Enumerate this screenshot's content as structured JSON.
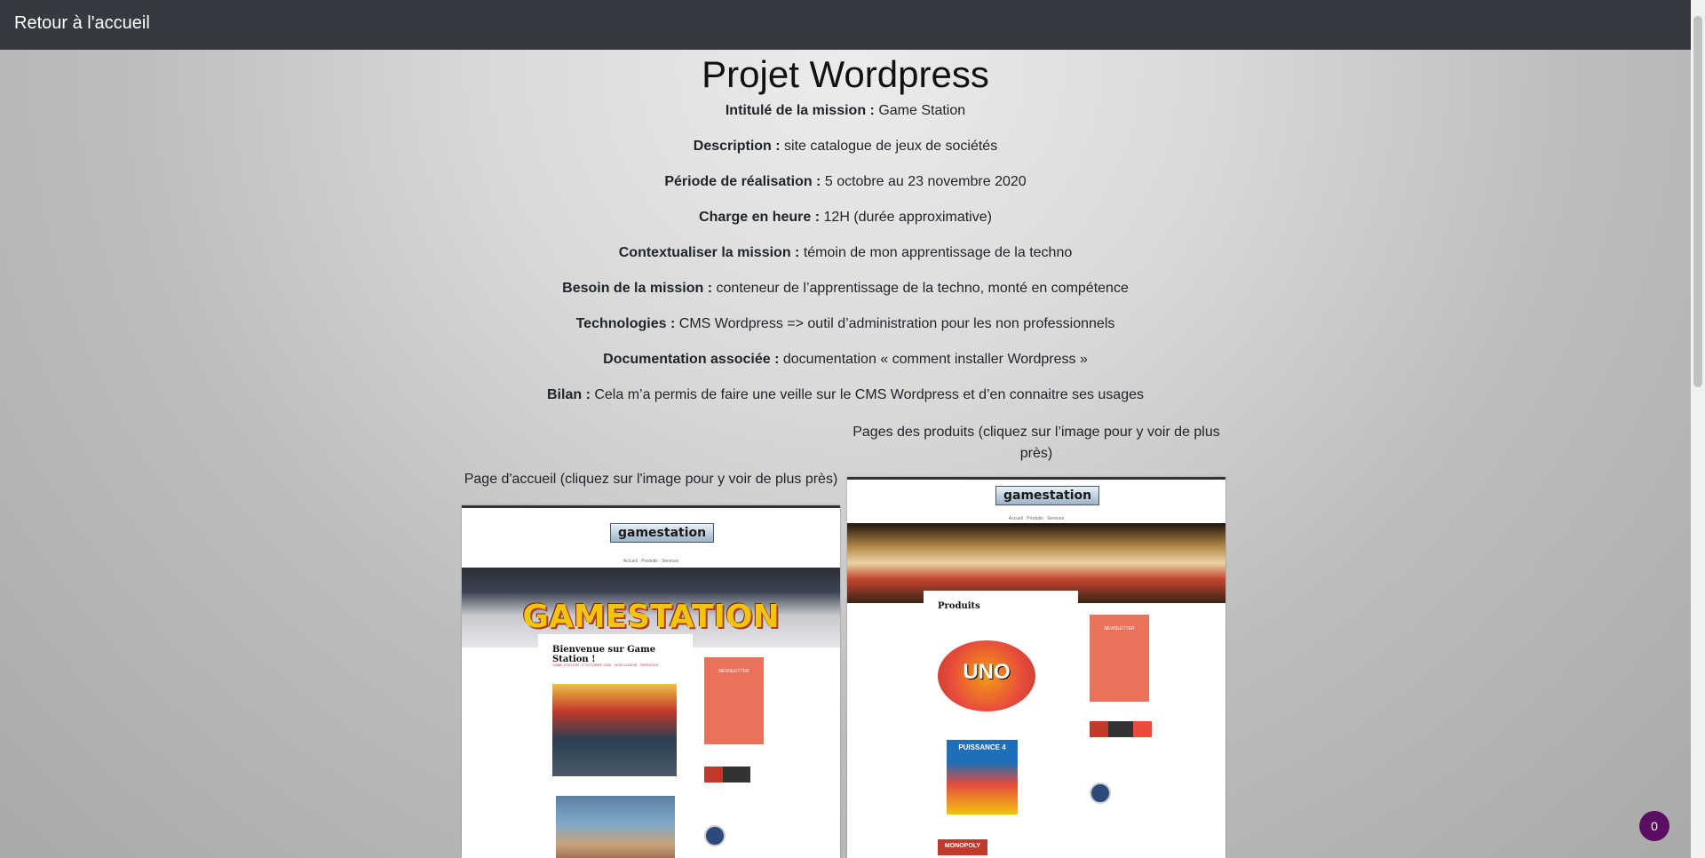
{
  "topbar": {
    "home_link": "Retour à l'accueil"
  },
  "page": {
    "title": "Projet Wordpress"
  },
  "fields": [
    {
      "label": "Intitulé de la mission :",
      "value": "Game Station"
    },
    {
      "label": "Description :",
      "value": "site catalogue de jeux de sociétés"
    },
    {
      "label": "Période de réalisation :",
      "value": "5 octobre au 23 novembre 2020"
    },
    {
      "label": "Charge en heure :",
      "value": "12H (durée approximative)"
    },
    {
      "label": "Contextualiser la mission :",
      "value": "témoin de mon apprentissage de la techno"
    },
    {
      "label": "Besoin de la mission :",
      "value": "conteneur de l’apprentissage de la techno, monté en compétence"
    },
    {
      "label": "Technologies :",
      "value": "CMS Wordpress => outil d’administration pour les non professionnels"
    },
    {
      "label": "Documentation associée :",
      "value": "documentation « comment installer Wordpress »"
    },
    {
      "label": "Bilan :",
      "value": "Cela m’a permis de faire une veille sur le CMS Wordpress et d’en connaitre ses usages"
    }
  ],
  "gallery": {
    "home_caption": "Page d'accueil (cliquez sur l'image pour y voir de plus près)",
    "products_caption_line1": "Pages des produits (cliquez sur l’image pour y voir de plus",
    "products_caption_line2": "près)"
  },
  "home_shot": {
    "logo": "gamestation",
    "nav": "Accueil · Produits · Services",
    "hero_text": "GAMESTATION",
    "card_title": "Bienvenue sur Game Station !",
    "card_meta": "GAME STATION · 5 OCTOBRE 2020 · NON CLASSÉ · SERVICES",
    "newsletter": "NEWSLETTER"
  },
  "products_shot": {
    "logo": "gamestation",
    "nav": "Accueil · Produits · Services",
    "card_title": "Produits",
    "product_1": "UNO",
    "product_2": "PUISSANCE 4",
    "product_3": "MONOPOLY",
    "newsletter": "NEWSLETTER"
  },
  "chat_widget": {
    "count": "0"
  },
  "colors": {
    "topbar": "#343a40",
    "chat": "#5c0e63",
    "newsletter": "#e8735a"
  }
}
